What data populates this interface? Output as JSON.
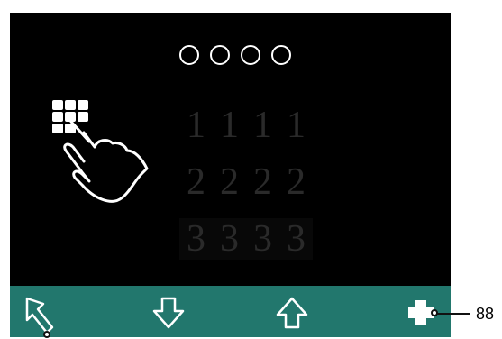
{
  "pin": {
    "entered_count": 0,
    "length": 4
  },
  "digit_columns": [
    [
      "1",
      "2",
      "3"
    ],
    [
      "1",
      "2",
      "3"
    ],
    [
      "1",
      "2",
      "3"
    ],
    [
      "1",
      "2",
      "3"
    ]
  ],
  "rows": [
    {
      "digits": [
        "1",
        "1",
        "1",
        "1"
      ]
    },
    {
      "digits": [
        "2",
        "2",
        "2",
        "2"
      ]
    },
    {
      "digits": [
        "3",
        "3",
        "3",
        "3"
      ]
    }
  ],
  "toolbar": {
    "buttons": [
      {
        "name": "back-button",
        "icon": "back-arrow-icon"
      },
      {
        "name": "down-button",
        "icon": "arrow-down-icon"
      },
      {
        "name": "up-button",
        "icon": "arrow-up-icon"
      },
      {
        "name": "add-button",
        "icon": "plus-icon"
      }
    ]
  },
  "callout": {
    "label": "88"
  },
  "colors": {
    "accent": "#22776d",
    "screen": "#000000",
    "digit": "#2a2a2a"
  }
}
